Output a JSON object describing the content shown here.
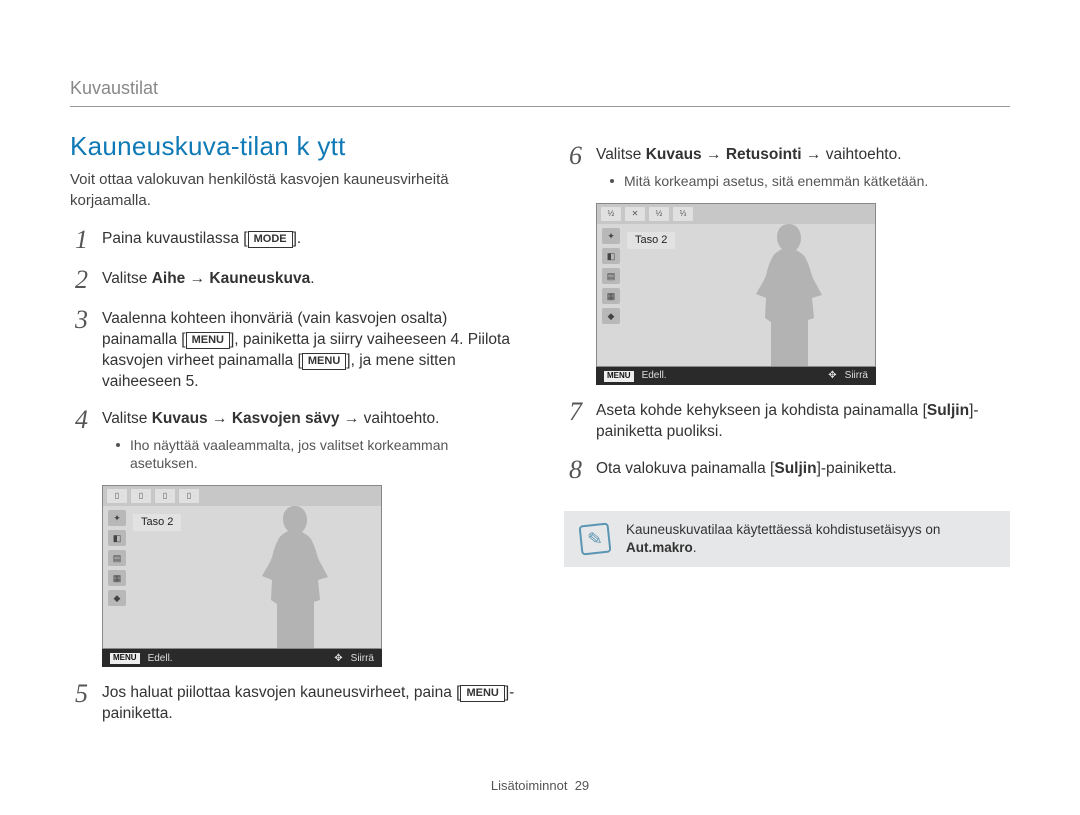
{
  "chapter": "Kuvaustilat",
  "title": "Kauneuskuva-tilan k  ytt",
  "intro": "Voit ottaa valokuvan henkilöstä kasvojen kauneusvirheitä korjaamalla.",
  "boxed": {
    "mode": "MODE",
    "menu": "MENU"
  },
  "arrow": "→",
  "steps_left": [
    {
      "num": "1",
      "plain_before": "Paina kuvaustilassa [",
      "boxed": "mode",
      "plain_after": "]."
    },
    {
      "num": "2",
      "parts": [
        "Valitse ",
        "<b>Aihe</b>",
        " → ",
        "<b>Kauneuskuva</b>",
        "."
      ]
    },
    {
      "num": "3",
      "parts": [
        "Vaalenna kohteen ihonväriä (vain kasvojen osalta) painamalla [",
        "<box:menu>",
        "], painiketta ja siirry vaiheeseen 4. Piilota kasvojen virheet painamalla [",
        "<box:menu>",
        "], ja mene sitten vaiheeseen 5."
      ]
    },
    {
      "num": "4",
      "parts": [
        "Valitse ",
        "<b>Kuvaus</b>",
        " → ",
        "<b>Kasvojen sävy</b>",
        " → vaihtoehto."
      ],
      "bullet": "Iho näyttää vaaleammalta, jos valitset korkeamman asetuksen."
    },
    {
      "num": "5",
      "parts": [
        "Jos haluat piilottaa kasvojen kauneusvirheet, paina [",
        "<box:menu>",
        "]-painiketta."
      ]
    }
  ],
  "steps_right": [
    {
      "num": "6",
      "parts": [
        "Valitse ",
        "<b>Kuvaus</b>",
        " → ",
        "<b>Retusointi</b>",
        " → vaihtoehto."
      ],
      "bullet": "Mitä korkeampi asetus, sitä enemmän kätketään."
    },
    {
      "num": "7",
      "parts": [
        "Aseta kohde kehykseen ja kohdista painamalla [",
        "<b>Suljin</b>",
        "]-painiketta puoliksi."
      ]
    },
    {
      "num": "8",
      "parts": [
        "Ota valokuva painamalla [",
        "<b>Suljin</b>",
        "]-painiketta."
      ]
    }
  ],
  "lcd": {
    "level_label": "Taso 2",
    "footer_menu": "MENU",
    "footer_prev": "Edell.",
    "footer_move": "Siirrä",
    "topbar_a": [
      "▯",
      "▯",
      "▯",
      "▯"
    ],
    "topbar_b": [
      "½",
      "✕",
      "½",
      "⅓"
    ]
  },
  "note": {
    "text_before": "Kauneuskuvatilaa käytettäessä kohdistusetäisyys on ",
    "text_bold": "Aut.makro",
    "text_after": "."
  },
  "footer": {
    "section": "Lisätoiminnot",
    "page": "29"
  }
}
